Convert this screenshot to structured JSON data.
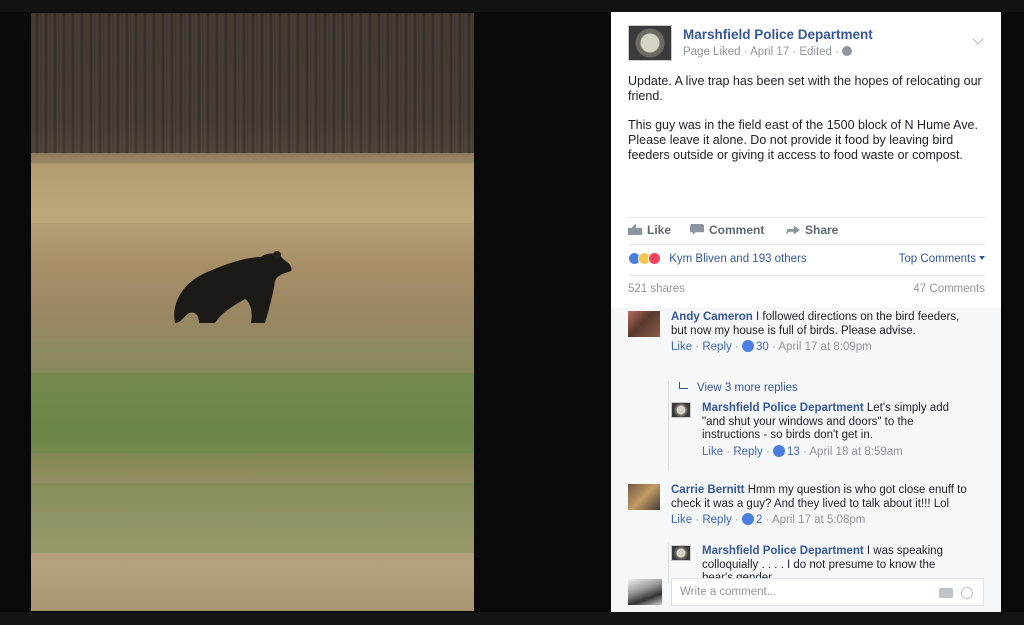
{
  "post": {
    "page_name": "Marshfield Police Department",
    "meta": "Page Liked · April 17 · Edited ·",
    "text_paragraphs": [
      "Update. A live trap has been set with the hopes of relocating our friend.",
      "This guy was in the field east of the 1500 block of N Hume Ave. Please leave it alone. Do not provide it food by leaving bird feeders outside or giving it access to food waste or compost."
    ]
  },
  "actions": {
    "like": "Like",
    "comment": "Comment",
    "share": "Share"
  },
  "reactions": {
    "names": "Kym Bliven and 193 others",
    "top_comments": "Top Comments",
    "shares": "521 shares",
    "comments_count": "47 Comments"
  },
  "comments": [
    {
      "name": "Andy Cameron",
      "text": "I followed directions on the bird feeders, but now my house is full of birds. Please advise.",
      "like": "Like",
      "reply": "Reply",
      "likes": "30",
      "time": "April 17 at 8:09pm"
    },
    {
      "view_replies": "View 3 more replies"
    },
    {
      "name": "Marshfield Police Department",
      "text": "Let's simply add \"and shut your windows and doors\" to the instructions - so birds don't get in.",
      "like": "Like",
      "reply": "Reply",
      "likes": "13",
      "time": "April 18 at 8:59am"
    },
    {
      "name": "Carrie Bernitt",
      "text": "Hmm my question is who got close enuff to check it was a guy? And they lived to talk about it!!! Lol",
      "like": "Like",
      "reply": "Reply",
      "likes": "2",
      "time": "April 17 at 5:08pm"
    },
    {
      "name": "Marshfield Police Department",
      "text": "I was speaking colloquially . . . . I do not presume to know the bear's gender . . ."
    }
  ],
  "write_comment": {
    "placeholder": "Write a comment..."
  },
  "icons": {
    "globe": "globe-icon",
    "chevron": "chevron-down-icon",
    "like": "thumbs-up-icon",
    "comment": "comment-icon",
    "share": "share-icon",
    "camera": "camera-icon",
    "emoji": "emoji-icon"
  },
  "colors": {
    "link": "#365899",
    "meta": "#90949c",
    "reaction_like": "#4a7fe0",
    "reaction_love": "#f0445f",
    "reaction_wow": "#f7c64f"
  }
}
